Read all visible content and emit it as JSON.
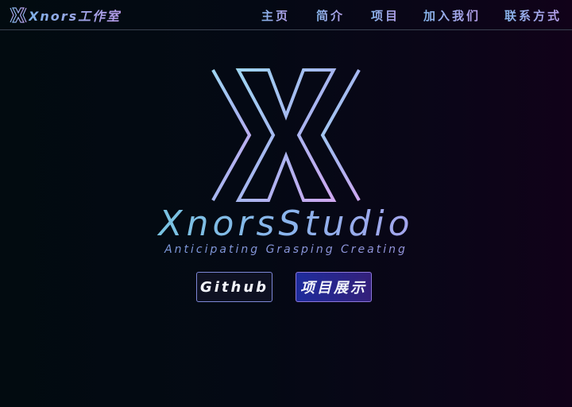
{
  "nav": {
    "brand_text": "Xnors工作室",
    "brand_icon": "x-logo-icon",
    "items": [
      {
        "label": "主页"
      },
      {
        "label": "简介"
      },
      {
        "label": "项目"
      },
      {
        "label": "加入我们"
      },
      {
        "label": "联系方式"
      }
    ]
  },
  "hero": {
    "logo_icon": "x-logo-icon",
    "title": "XnorsStudio",
    "subtitle": "Anticipating Grasping Creating",
    "buttons": {
      "github": "Github",
      "projects": "项目展示"
    }
  },
  "colors": {
    "accent_cyan": "#63d6d3",
    "accent_blue": "#8ab4ec",
    "accent_purple": "#c792ee",
    "button_primary": "#1e2c9c"
  }
}
